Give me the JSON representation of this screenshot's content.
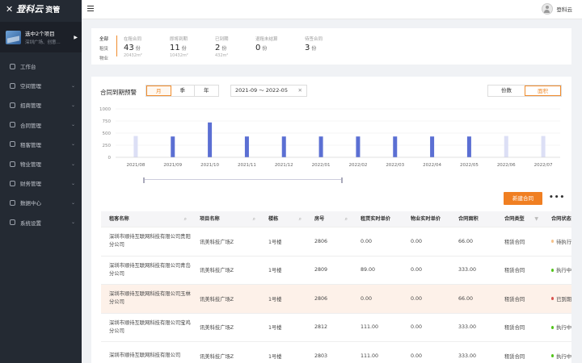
{
  "brand": {
    "logo_mark": "✕",
    "name": "登科云",
    "suffix": "资管"
  },
  "project": {
    "title": "选中2个项目",
    "subtitle": "深圳广场、创意...",
    "arrow": "▶"
  },
  "nav": [
    {
      "label": "工作台",
      "chev": ""
    },
    {
      "label": "空间管理",
      "chev": "⌄"
    },
    {
      "label": "招商管理",
      "chev": "⌄"
    },
    {
      "label": "合同管理",
      "chev": "⌄"
    },
    {
      "label": "租客管理",
      "chev": "⌄"
    },
    {
      "label": "物业管理",
      "chev": "⌄"
    },
    {
      "label": "财务管理",
      "chev": "⌄"
    },
    {
      "label": "数据中心",
      "chev": "⌄"
    },
    {
      "label": "系统设置",
      "chev": "⌄"
    }
  ],
  "user": {
    "name": "登科云"
  },
  "stats": {
    "types": [
      "全部",
      "租赁",
      "物业"
    ],
    "items": [
      {
        "label": "在租合同",
        "value": "43",
        "unit": "份",
        "sub": "20432m²"
      },
      {
        "label": "即将到期",
        "value": "11",
        "unit": "份",
        "sub": "10432m²"
      },
      {
        "label": "已到期",
        "value": "2",
        "unit": "份",
        "sub": "432m²"
      },
      {
        "label": "退租未结算",
        "value": "0",
        "unit": "份",
        "sub": ""
      },
      {
        "label": "待签合同",
        "value": "3",
        "unit": "份",
        "sub": ""
      }
    ]
  },
  "panel": {
    "title": "合同到期预警",
    "periods": [
      "月",
      "季",
      "年"
    ],
    "range": "2021-09 ～ 2022-05",
    "range_clear": "✕",
    "metrics": [
      "份数",
      "面积"
    ],
    "new_button": "新建合同",
    "more": "•••"
  },
  "chart_data": {
    "type": "bar",
    "categories": [
      "2021/08",
      "2021/09",
      "2021/10",
      "2021/11",
      "2021/12",
      "2022/01",
      "2022/02",
      "2022/03",
      "2022/04",
      "2022/05",
      "2022/06",
      "2022/07"
    ],
    "values": [
      440,
      430,
      720,
      430,
      430,
      430,
      430,
      430,
      430,
      430,
      440,
      440
    ],
    "highlighted": [
      false,
      true,
      true,
      true,
      true,
      true,
      true,
      true,
      true,
      true,
      false,
      false
    ],
    "yticks": [
      "0",
      "250",
      "500",
      "750",
      "1000"
    ],
    "ylim": [
      0,
      1000
    ],
    "colors": {
      "active": "#5b6fd3",
      "inactive": "#dcdff5"
    }
  },
  "table": {
    "headers": [
      "租客名称",
      "项目名称",
      "楼栋",
      "房号",
      "租赁实时单价",
      "物业实时单价",
      "合同面积",
      "合同类型",
      "合同状态"
    ],
    "rows": [
      {
        "tenant": "深圳市顺待互联网科技有限公司贵阳分公司",
        "project": "讯美科技广场Z",
        "building": "1号楼",
        "room": "2806",
        "rent": "0.00",
        "prop": "0.00",
        "area": "66.00",
        "type": "租赁合同",
        "status": "待执行",
        "dot": "#f5c28a",
        "hl": false
      },
      {
        "tenant": "深圳市顺待互联网科技有限公司青岛分公司",
        "project": "讯美科技广场Z",
        "building": "1号楼",
        "room": "2809",
        "rent": "89.00",
        "prop": "0.00",
        "area": "333.00",
        "type": "租赁合同",
        "status": "执行中",
        "dot": "#52c41a",
        "hl": false
      },
      {
        "tenant": "深圳市顺待互联网科技有限公司玉林分公司",
        "project": "讯美科技广场Z",
        "building": "1号楼",
        "room": "2806",
        "rent": "0.00",
        "prop": "0.00",
        "area": "66.00",
        "type": "租赁合同",
        "status": "已到期",
        "dot": "#d9534f",
        "hl": true
      },
      {
        "tenant": "深圳市顺待互联网科技有限公司宝鸡分公司",
        "project": "讯美科技广场Z",
        "building": "1号楼",
        "room": "2812",
        "rent": "111.00",
        "prop": "0.00",
        "area": "333.00",
        "type": "租赁合同",
        "status": "执行中",
        "dot": "#52c41a",
        "hl": false
      },
      {
        "tenant": "深圳市顺待互联网科技有限公司",
        "project": "讯美科技广场Z",
        "building": "1号楼",
        "room": "2803",
        "rent": "111.00",
        "prop": "0.00",
        "area": "333.00",
        "type": "租赁合同",
        "status": "执行中",
        "dot": "#52c41a",
        "hl": false
      }
    ]
  }
}
